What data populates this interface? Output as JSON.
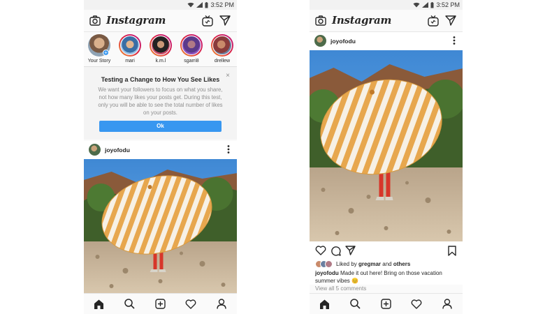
{
  "status_bar": {
    "time": "3:52 PM"
  },
  "app": {
    "logo": "Instagram"
  },
  "stories": [
    {
      "name": "Your Story",
      "own": true
    },
    {
      "name": "mari",
      "own": false
    },
    {
      "name": "k.m.l",
      "own": false
    },
    {
      "name": "sgarri8",
      "own": false
    },
    {
      "name": "drellew",
      "own": false
    }
  ],
  "notice": {
    "close": "×",
    "title": "Testing a Change to How You See Likes",
    "body": "We want your followers to focus on what you share, not how many likes your posts get. During this test, only you will be able to see the total number of likes on your posts.",
    "ok_label": "Ok"
  },
  "post": {
    "username": "joyofodu",
    "liked_by_prefix": "Liked by ",
    "liked_by_user": "gregmar",
    "liked_by_and": " and ",
    "liked_by_others": "others",
    "caption_user": "joyofodu",
    "caption_text": " Made it out here! Bring on those vacation summer vibes 😊",
    "view_comments": "View all 5 comments"
  },
  "icons": {
    "header": [
      "camera-icon",
      "igtv-icon",
      "direct-message-icon"
    ],
    "nav": [
      "home-icon",
      "search-icon",
      "add-post-icon",
      "activity-heart-icon",
      "profile-icon"
    ],
    "post_actions": [
      "like-heart-icon",
      "comment-icon",
      "share-icon",
      "bookmark-icon",
      "more-options-icon"
    ]
  },
  "colors": {
    "accent": "#3897f0",
    "story_ring": "#dc2743"
  }
}
